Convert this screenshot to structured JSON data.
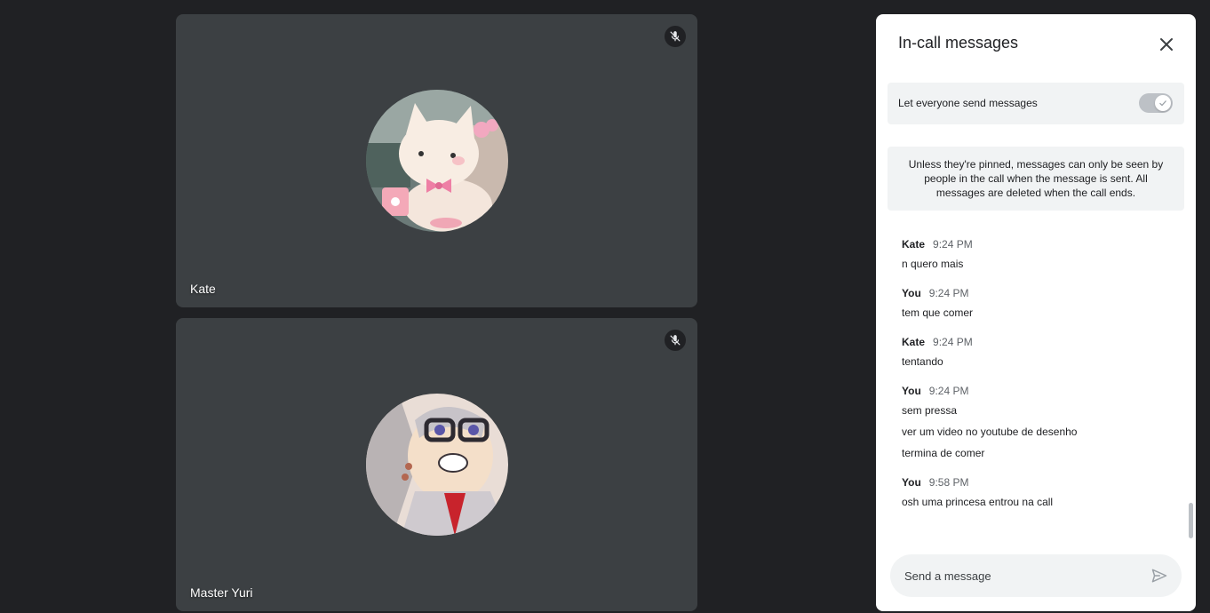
{
  "tiles": [
    {
      "name": "Kate",
      "mic_icon": "mic-off-icon",
      "avatar": "hello-kitty-avatar"
    },
    {
      "name": "Master Yuri",
      "mic_icon": "mic-off-icon",
      "avatar": "anime-glasses-avatar"
    }
  ],
  "panel": {
    "title": "In-call messages",
    "close_icon": "close-icon",
    "setting_label": "Let everyone send messages",
    "setting_enabled": true,
    "notice": "Unless they're pinned, messages can only be seen by people in the call when the message is sent. All messages are deleted when the call ends.",
    "messages": [
      {
        "sender": "Kate",
        "time": "9:24 PM",
        "lines": [
          "n quero mais"
        ]
      },
      {
        "sender": "You",
        "time": "9:24 PM",
        "lines": [
          "tem que comer"
        ]
      },
      {
        "sender": "Kate",
        "time": "9:24 PM",
        "lines": [
          "tentando"
        ]
      },
      {
        "sender": "You",
        "time": "9:24 PM",
        "lines": [
          "sem pressa",
          "ver um video no youtube de desenho",
          "termina de comer"
        ]
      },
      {
        "sender": "You",
        "time": "9:58 PM",
        "lines": [
          "osh uma princesa entrou na call"
        ]
      }
    ],
    "composer_placeholder": "Send a message",
    "send_icon": "send-icon"
  },
  "colors": {
    "background": "#202124",
    "tile": "#3c4043",
    "panel": "#ffffff",
    "accent_gray": "#f1f3f4"
  }
}
